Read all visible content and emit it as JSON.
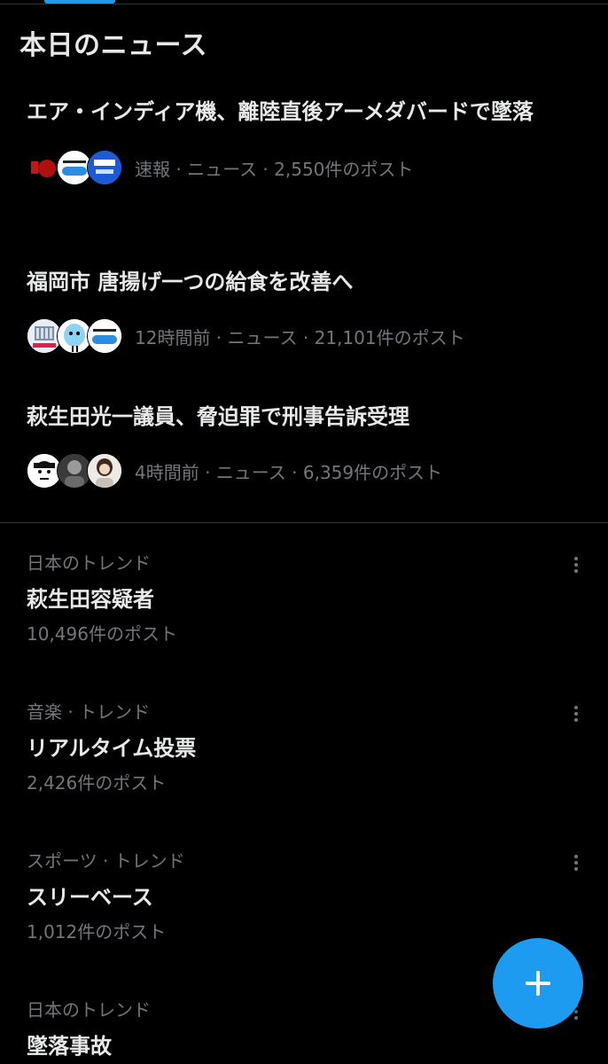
{
  "colors": {
    "background": "#000000",
    "primary_text": "#e7e9ea",
    "secondary_text": "#71767b",
    "accent": "#1d9bf0",
    "divider": "#2f3336"
  },
  "today_news": {
    "title": "本日のニュース",
    "items": [
      {
        "headline": "エア・インディア機、離陸直後アーメダバードで墜落",
        "meta": "速報 · ニュース · 2,550件のポスト",
        "avatar_icons": [
          "news-logo-icon",
          "abema-news-logo-icon",
          "nhk-news-logo-icon"
        ]
      },
      {
        "headline": "福岡市 唐揚げ一つの給食を改善へ",
        "meta": "12時間前 · ニュース · 21,101件のポスト",
        "avatar_icons": [
          "building-photo-icon",
          "cartoon-character-icon",
          "news-logo-icon"
        ]
      },
      {
        "headline": "萩生田光一議員、脅迫罪で刑事告訴受理",
        "meta": "4時間前 · ニュース · 6,359件のポスト",
        "avatar_icons": [
          "cartoon-face-icon",
          "person-photo-icon",
          "person-photo-icon"
        ]
      }
    ]
  },
  "trends": [
    {
      "category": "日本のトレンド",
      "name": "萩生田容疑者",
      "count": "10,496件のポスト"
    },
    {
      "category": "音楽 · トレンド",
      "name": "リアルタイム投票",
      "count": "2,426件のポスト"
    },
    {
      "category": "スポーツ · トレンド",
      "name": "スリーベース",
      "count": "1,012件のポスト"
    },
    {
      "category": "日本のトレンド",
      "name": "墜落事故",
      "count": ""
    }
  ],
  "fab": {
    "icon": "plus-icon"
  }
}
